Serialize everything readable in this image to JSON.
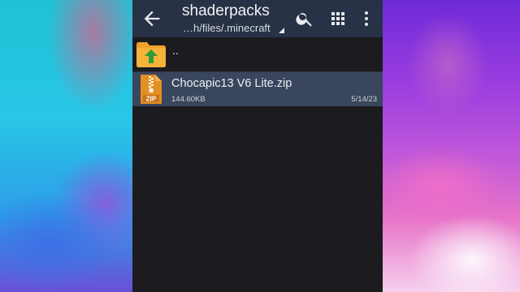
{
  "appbar": {
    "title": "shaderpacks",
    "path": "…h/files/.minecraft",
    "icons": [
      "back-arrow-icon",
      "search-icon",
      "grid-view-icon",
      "more-vert-icon"
    ]
  },
  "list": {
    "up_label": "..",
    "items": [
      {
        "name": "Chocapic13 V6 Lite.zip",
        "size": "144.60KB",
        "date": "5/14/23",
        "icon": "zip-file-icon",
        "icon_text": "ZIP"
      }
    ]
  },
  "colors": {
    "appbar": "#273246",
    "background": "#1c1b20",
    "selected_row": "#3a465e",
    "folder": "#f0a329",
    "up_arrow": "#2e9a3a",
    "zip": "#e39022"
  }
}
